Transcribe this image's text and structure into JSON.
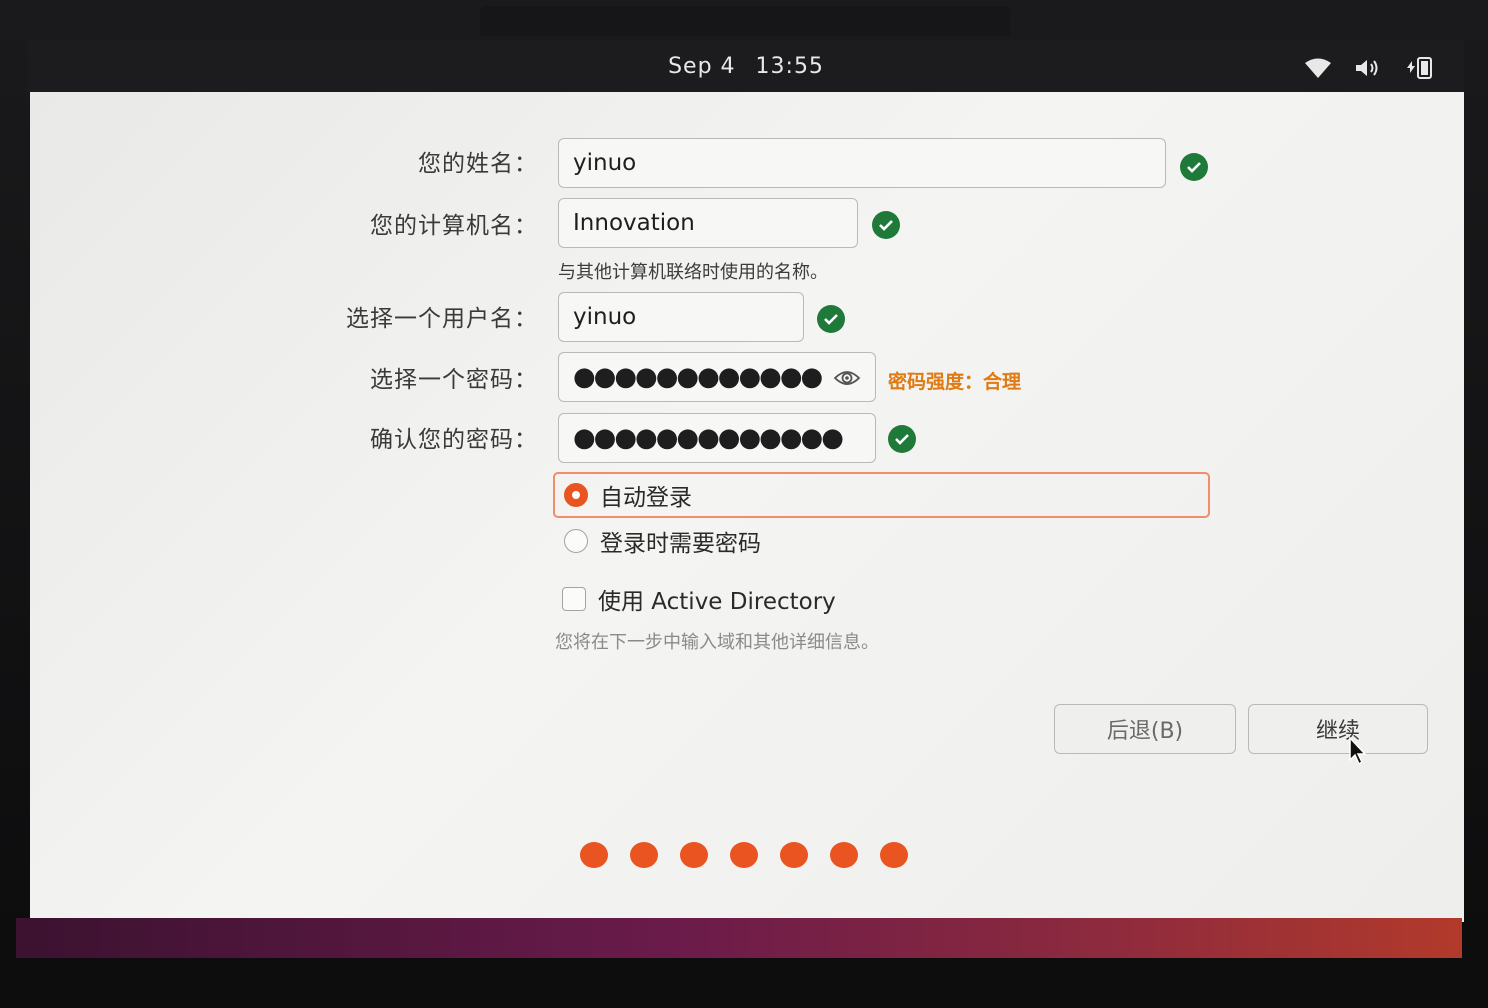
{
  "top_bar": {
    "date": "Sep 4",
    "time": "13:55",
    "icons": [
      "wifi-icon",
      "volume-icon",
      "battery-icon"
    ]
  },
  "form": {
    "name": {
      "label": "您的姓名：",
      "value": "yinuo",
      "valid": true
    },
    "computer_name": {
      "label": "您的计算机名：",
      "value": "Innovation",
      "valid": true,
      "hint": "与其他计算机联络时使用的名称。"
    },
    "username": {
      "label": "选择一个用户名：",
      "value": "yinuo",
      "valid": true
    },
    "password": {
      "label": "选择一个密码：",
      "masked_value": "●●●●●●●●●●●●",
      "strength": "密码强度：合理"
    },
    "confirm_password": {
      "label": "确认您的密码：",
      "masked_value": "●●●●●●●●●●●●●",
      "valid": true
    }
  },
  "login_options": {
    "auto_login": {
      "label": "自动登录",
      "selected": true
    },
    "require_password": {
      "label": "登录时需要密码",
      "selected": false
    }
  },
  "active_directory": {
    "label": "使用 Active Directory",
    "checked": false,
    "hint": "您将在下一步中输入域和其他详细信息。"
  },
  "buttons": {
    "back": "后退(B)",
    "continue": "继续"
  },
  "progress": {
    "total_steps": 7
  },
  "colors": {
    "accent": "#e95420",
    "valid": "#1f7a3a",
    "strength_text": "#e07a12"
  }
}
